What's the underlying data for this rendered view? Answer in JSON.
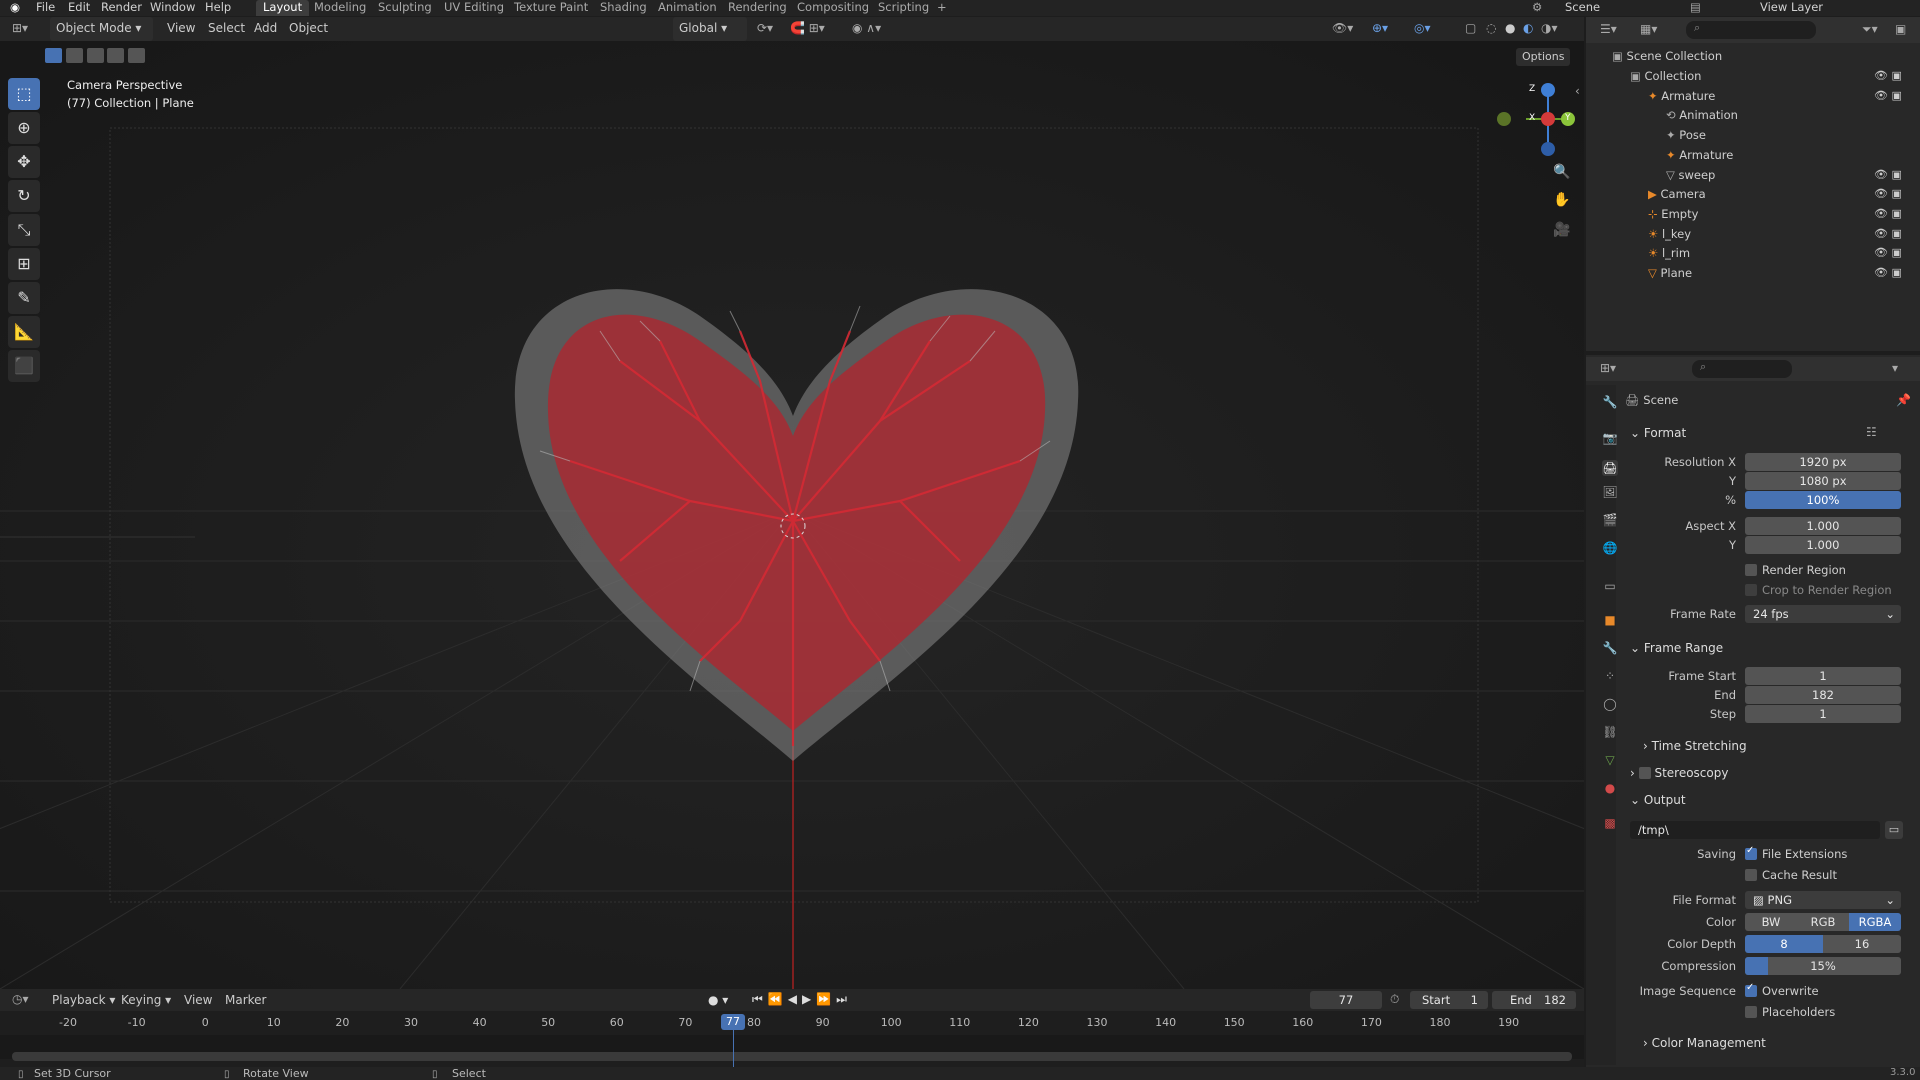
{
  "topbar": {
    "menus": [
      "File",
      "Edit",
      "Render",
      "Window",
      "Help"
    ],
    "tabs": [
      "Layout",
      "Modeling",
      "Sculpting",
      "UV Editing",
      "Texture Paint",
      "Shading",
      "Animation",
      "Rendering",
      "Compositing",
      "Scripting"
    ],
    "add_tab": "+",
    "scene": "Scene",
    "view_layer": "View Layer"
  },
  "viewport_header": {
    "mode": "Object Mode",
    "menus": [
      "View",
      "Select",
      "Add",
      "Object"
    ],
    "transform": "Global",
    "options": "Options"
  },
  "viewport": {
    "camera_label": "Camera Perspective",
    "collection_label": "(77) Collection | Plane",
    "gizmo": {
      "z": "Z",
      "x": "X",
      "y": "Y"
    }
  },
  "outliner": {
    "root": "Scene Collection",
    "items": [
      {
        "label": "Collection",
        "indent": 1
      },
      {
        "label": "Armature",
        "indent": 2
      },
      {
        "label": "Animation",
        "indent": 3
      },
      {
        "label": "Pose",
        "indent": 3
      },
      {
        "label": "Armature",
        "indent": 3
      },
      {
        "label": "sweep",
        "indent": 3
      },
      {
        "label": "Camera",
        "indent": 2
      },
      {
        "label": "Empty",
        "indent": 2
      },
      {
        "label": "l_key",
        "indent": 2
      },
      {
        "label": "l_rim",
        "indent": 2
      },
      {
        "label": "Plane",
        "indent": 2
      }
    ]
  },
  "properties": {
    "context": "Scene",
    "format": {
      "title": "Format",
      "res_x_label": "Resolution X",
      "res_x": "1920 px",
      "res_y_label": "Y",
      "res_y": "1080 px",
      "pct_label": "%",
      "pct": "100%",
      "aspect_x_label": "Aspect X",
      "aspect_x": "1.000",
      "aspect_y_label": "Y",
      "aspect_y": "1.000",
      "render_region": "Render Region",
      "crop": "Crop to Render Region",
      "frame_rate_label": "Frame Rate",
      "frame_rate": "24 fps"
    },
    "frame_range": {
      "title": "Frame Range",
      "start_label": "Frame Start",
      "start": "1",
      "end_label": "End",
      "end": "182",
      "step_label": "Step",
      "step": "1"
    },
    "time_stretching": "Time Stretching",
    "stereoscopy": "Stereoscopy",
    "output": {
      "title": "Output",
      "path": "/tmp\\",
      "saving_label": "Saving",
      "file_ext": "File Extensions",
      "cache": "Cache Result",
      "file_format_label": "File Format",
      "file_format": "PNG",
      "color_label": "Color",
      "color_opts": [
        "BW",
        "RGB",
        "RGBA"
      ],
      "depth_label": "Color Depth",
      "depth_opts": [
        "8",
        "16"
      ],
      "compression_label": "Compression",
      "compression": "15%",
      "img_seq_label": "Image Sequence",
      "overwrite": "Overwrite",
      "placeholders": "Placeholders"
    },
    "color_management": "Color Management"
  },
  "timeline": {
    "menus": [
      "Playback",
      "Keying",
      "View",
      "Marker"
    ],
    "current": "77",
    "start_label": "Start",
    "start": "1",
    "end_label": "End",
    "end": "182",
    "ticks": [
      "-20",
      "-10",
      "0",
      "10",
      "20",
      "30",
      "40",
      "50",
      "60",
      "70",
      "80",
      "90",
      "100",
      "110",
      "120",
      "130",
      "140",
      "150",
      "160",
      "170",
      "180",
      "190"
    ],
    "playhead": "77"
  },
  "statusbar": {
    "items": [
      "Set 3D Cursor",
      "Rotate View",
      "Select"
    ],
    "version": "3.3.0"
  },
  "colors": {
    "accent": "#4772b3",
    "heart_red": "#c8232d",
    "heart_gray": "#9a9a9a"
  }
}
